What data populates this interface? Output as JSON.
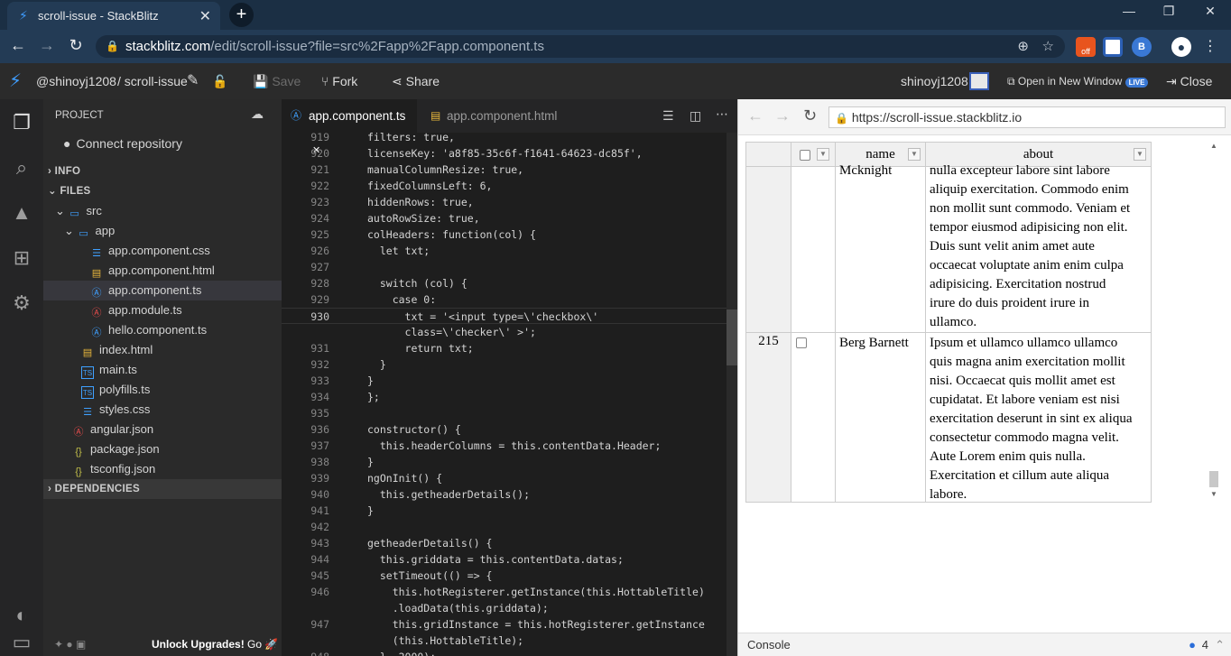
{
  "browser": {
    "tab_title": "scroll-issue - StackBlitz",
    "tab_close": "✕",
    "new_tab": "+",
    "url_domain": "stackblitz.com",
    "url_rest": "/edit/scroll-issue?file=src%2Fapp%2Fapp.component.ts",
    "ext_off_label": "off",
    "ext_b_label": "B",
    "win_min": "—",
    "win_max": "❐",
    "win_close": "✕"
  },
  "header": {
    "user": "@shinoyj1208",
    "project": "/ scroll-issue",
    "save_label": "Save",
    "fork_label": "Fork",
    "share_label": "Share",
    "account": "shinoyj1208",
    "open_new_window": "Open in New Window",
    "live_badge": "LIVE",
    "close_label": "Close"
  },
  "sidebar": {
    "project_label": "PROJECT",
    "connect_repo": "Connect repository",
    "info": "INFO",
    "files": "FILES",
    "tree": {
      "src": "src",
      "app": "app",
      "app_component_css": "app.component.css",
      "app_component_html": "app.component.html",
      "app_component_ts": "app.component.ts",
      "app_module_ts": "app.module.ts",
      "hello_component_ts": "hello.component.ts",
      "index_html": "index.html",
      "main_ts": "main.ts",
      "polyfills_ts": "polyfills.ts",
      "styles_css": "styles.css",
      "angular_json": "angular.json",
      "package_json": "package.json",
      "tsconfig_json": "tsconfig.json"
    },
    "dependencies": "DEPENDENCIES",
    "unlock": "Unlock Upgrades!",
    "go": "Go"
  },
  "editor": {
    "tabs": [
      {
        "label": "app.component.ts",
        "close": "✕"
      },
      {
        "label": "app.component.html"
      }
    ],
    "lines": [
      {
        "n": "919",
        "t": "filters: true,"
      },
      {
        "n": "920",
        "t": "licenseKey: 'a8f85-35c6f-f1641-64623-dc85f',"
      },
      {
        "n": "921",
        "t": "manualColumnResize: true,"
      },
      {
        "n": "922",
        "t": "fixedColumnsLeft: 6,"
      },
      {
        "n": "923",
        "t": "hiddenRows: true,"
      },
      {
        "n": "924",
        "t": "autoRowSize: true,"
      },
      {
        "n": "925",
        "t": "colHeaders: function(col) {"
      },
      {
        "n": "926",
        "t": "  let txt;"
      },
      {
        "n": "927",
        "t": ""
      },
      {
        "n": "928",
        "t": "  switch (col) {"
      },
      {
        "n": "929",
        "t": "    case 0:"
      },
      {
        "n": "930",
        "t": "      txt = '<input type=\\'checkbox\\'"
      },
      {
        "n": "",
        "t": "      class=\\'checker\\' >';"
      },
      {
        "n": "931",
        "t": "      return txt;"
      },
      {
        "n": "932",
        "t": "  }"
      },
      {
        "n": "933",
        "t": "}"
      },
      {
        "n": "934",
        "t": "};"
      },
      {
        "n": "935",
        "t": ""
      },
      {
        "n": "936",
        "t": "constructor() {"
      },
      {
        "n": "937",
        "t": "  this.headerColumns = this.contentData.Header;"
      },
      {
        "n": "938",
        "t": "}"
      },
      {
        "n": "939",
        "t": "ngOnInit() {"
      },
      {
        "n": "940",
        "t": "  this.getheaderDetails();"
      },
      {
        "n": "941",
        "t": "}"
      },
      {
        "n": "942",
        "t": ""
      },
      {
        "n": "943",
        "t": "getheaderDetails() {"
      },
      {
        "n": "944",
        "t": "  this.griddata = this.contentData.datas;"
      },
      {
        "n": "945",
        "t": "  setTimeout(() => {"
      },
      {
        "n": "946",
        "t": "    this.hotRegisterer.getInstance(this.HottableTitle)"
      },
      {
        "n": "",
        "t": "    .loadData(this.griddata);"
      },
      {
        "n": "947",
        "t": "    this.gridInstance = this.hotRegisterer.getInstance"
      },
      {
        "n": "",
        "t": "    (this.HottableTitle);"
      },
      {
        "n": "948",
        "t": "  }, 2000);"
      }
    ]
  },
  "preview": {
    "url": "https://scroll-issue.stackblitz.io",
    "grid": {
      "col_name": "name",
      "col_about": "about",
      "dropdown_glyph": "▼",
      "rows": [
        {
          "id": "",
          "name": "Mcknight",
          "about_lines": [
            "nulla excepteur labore sint labore",
            "aliquip exercitation. Commodo enim",
            "non mollit sunt commodo. Veniam et",
            "tempor eiusmod adipisicing non elit.",
            "Duis sunt velit anim amet aute",
            "occaecat voluptate anim enim culpa",
            "adipisicing. Exercitation nostrud",
            "irure do duis proident irure in",
            "ullamco."
          ]
        },
        {
          "id": "215",
          "name": "Berg Barnett",
          "about_lines": [
            "Ipsum et ullamco ullamco ullamco",
            "quis magna anim exercitation mollit",
            "nisi. Occaecat quis mollit amet est",
            "cupidatat. Et labore veniam est nisi",
            "exercitation deserunt in sint ex aliqua",
            "consectetur commodo magna velit.",
            "Aute Lorem enim quis nulla.",
            "Exercitation et cillum aute aliqua",
            "labore."
          ]
        }
      ]
    },
    "console_label": "Console",
    "console_count": "4"
  }
}
